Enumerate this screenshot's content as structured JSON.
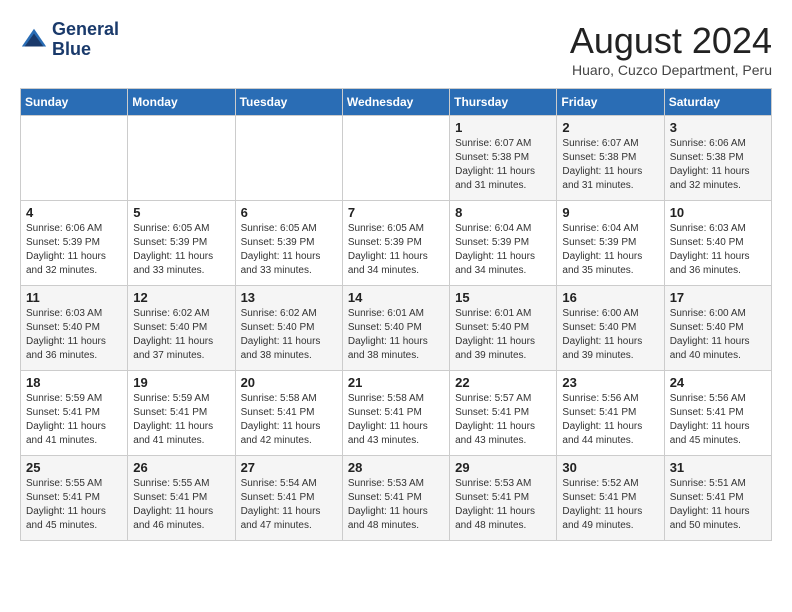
{
  "header": {
    "logo_line1": "General",
    "logo_line2": "Blue",
    "month": "August 2024",
    "location": "Huaro, Cuzco Department, Peru"
  },
  "weekdays": [
    "Sunday",
    "Monday",
    "Tuesday",
    "Wednesday",
    "Thursday",
    "Friday",
    "Saturday"
  ],
  "weeks": [
    [
      {
        "day": "",
        "detail": ""
      },
      {
        "day": "",
        "detail": ""
      },
      {
        "day": "",
        "detail": ""
      },
      {
        "day": "",
        "detail": ""
      },
      {
        "day": "1",
        "detail": "Sunrise: 6:07 AM\nSunset: 5:38 PM\nDaylight: 11 hours\nand 31 minutes."
      },
      {
        "day": "2",
        "detail": "Sunrise: 6:07 AM\nSunset: 5:38 PM\nDaylight: 11 hours\nand 31 minutes."
      },
      {
        "day": "3",
        "detail": "Sunrise: 6:06 AM\nSunset: 5:38 PM\nDaylight: 11 hours\nand 32 minutes."
      }
    ],
    [
      {
        "day": "4",
        "detail": "Sunrise: 6:06 AM\nSunset: 5:39 PM\nDaylight: 11 hours\nand 32 minutes."
      },
      {
        "day": "5",
        "detail": "Sunrise: 6:05 AM\nSunset: 5:39 PM\nDaylight: 11 hours\nand 33 minutes."
      },
      {
        "day": "6",
        "detail": "Sunrise: 6:05 AM\nSunset: 5:39 PM\nDaylight: 11 hours\nand 33 minutes."
      },
      {
        "day": "7",
        "detail": "Sunrise: 6:05 AM\nSunset: 5:39 PM\nDaylight: 11 hours\nand 34 minutes."
      },
      {
        "day": "8",
        "detail": "Sunrise: 6:04 AM\nSunset: 5:39 PM\nDaylight: 11 hours\nand 34 minutes."
      },
      {
        "day": "9",
        "detail": "Sunrise: 6:04 AM\nSunset: 5:39 PM\nDaylight: 11 hours\nand 35 minutes."
      },
      {
        "day": "10",
        "detail": "Sunrise: 6:03 AM\nSunset: 5:40 PM\nDaylight: 11 hours\nand 36 minutes."
      }
    ],
    [
      {
        "day": "11",
        "detail": "Sunrise: 6:03 AM\nSunset: 5:40 PM\nDaylight: 11 hours\nand 36 minutes."
      },
      {
        "day": "12",
        "detail": "Sunrise: 6:02 AM\nSunset: 5:40 PM\nDaylight: 11 hours\nand 37 minutes."
      },
      {
        "day": "13",
        "detail": "Sunrise: 6:02 AM\nSunset: 5:40 PM\nDaylight: 11 hours\nand 38 minutes."
      },
      {
        "day": "14",
        "detail": "Sunrise: 6:01 AM\nSunset: 5:40 PM\nDaylight: 11 hours\nand 38 minutes."
      },
      {
        "day": "15",
        "detail": "Sunrise: 6:01 AM\nSunset: 5:40 PM\nDaylight: 11 hours\nand 39 minutes."
      },
      {
        "day": "16",
        "detail": "Sunrise: 6:00 AM\nSunset: 5:40 PM\nDaylight: 11 hours\nand 39 minutes."
      },
      {
        "day": "17",
        "detail": "Sunrise: 6:00 AM\nSunset: 5:40 PM\nDaylight: 11 hours\nand 40 minutes."
      }
    ],
    [
      {
        "day": "18",
        "detail": "Sunrise: 5:59 AM\nSunset: 5:41 PM\nDaylight: 11 hours\nand 41 minutes."
      },
      {
        "day": "19",
        "detail": "Sunrise: 5:59 AM\nSunset: 5:41 PM\nDaylight: 11 hours\nand 41 minutes."
      },
      {
        "day": "20",
        "detail": "Sunrise: 5:58 AM\nSunset: 5:41 PM\nDaylight: 11 hours\nand 42 minutes."
      },
      {
        "day": "21",
        "detail": "Sunrise: 5:58 AM\nSunset: 5:41 PM\nDaylight: 11 hours\nand 43 minutes."
      },
      {
        "day": "22",
        "detail": "Sunrise: 5:57 AM\nSunset: 5:41 PM\nDaylight: 11 hours\nand 43 minutes."
      },
      {
        "day": "23",
        "detail": "Sunrise: 5:56 AM\nSunset: 5:41 PM\nDaylight: 11 hours\nand 44 minutes."
      },
      {
        "day": "24",
        "detail": "Sunrise: 5:56 AM\nSunset: 5:41 PM\nDaylight: 11 hours\nand 45 minutes."
      }
    ],
    [
      {
        "day": "25",
        "detail": "Sunrise: 5:55 AM\nSunset: 5:41 PM\nDaylight: 11 hours\nand 45 minutes."
      },
      {
        "day": "26",
        "detail": "Sunrise: 5:55 AM\nSunset: 5:41 PM\nDaylight: 11 hours\nand 46 minutes."
      },
      {
        "day": "27",
        "detail": "Sunrise: 5:54 AM\nSunset: 5:41 PM\nDaylight: 11 hours\nand 47 minutes."
      },
      {
        "day": "28",
        "detail": "Sunrise: 5:53 AM\nSunset: 5:41 PM\nDaylight: 11 hours\nand 48 minutes."
      },
      {
        "day": "29",
        "detail": "Sunrise: 5:53 AM\nSunset: 5:41 PM\nDaylight: 11 hours\nand 48 minutes."
      },
      {
        "day": "30",
        "detail": "Sunrise: 5:52 AM\nSunset: 5:41 PM\nDaylight: 11 hours\nand 49 minutes."
      },
      {
        "day": "31",
        "detail": "Sunrise: 5:51 AM\nSunset: 5:41 PM\nDaylight: 11 hours\nand 50 minutes."
      }
    ]
  ]
}
